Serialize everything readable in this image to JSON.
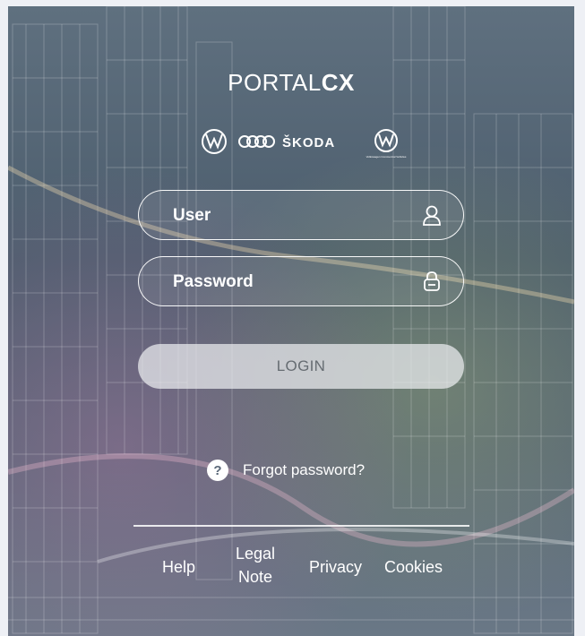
{
  "brand": {
    "prefix": "PORTAL",
    "suffix": "CX"
  },
  "logos": [
    {
      "name": "vw-logo-icon"
    },
    {
      "name": "audi-rings-icon"
    },
    {
      "name": "skoda-wordmark",
      "text": "ŠKODA"
    },
    {
      "name": "vw-commercial-logo-icon",
      "text": "Volkswagen Commercial Vehicles"
    }
  ],
  "login_form": {
    "user": {
      "placeholder": "User",
      "value": "",
      "icon": "user-icon"
    },
    "password": {
      "placeholder": "Password",
      "value": "",
      "icon": "lock-icon"
    },
    "login_label": "LOGIN"
  },
  "forgot": {
    "label": "Forgot password?",
    "icon": "question-icon"
  },
  "footer": {
    "help": "Help",
    "legal_line1": "Legal",
    "legal_line2": "Note",
    "privacy": "Privacy",
    "cookies": "Cookies"
  },
  "colors": {
    "text": "#ffffff",
    "button_bg": "#ebedf0",
    "button_text": "#666c72"
  }
}
